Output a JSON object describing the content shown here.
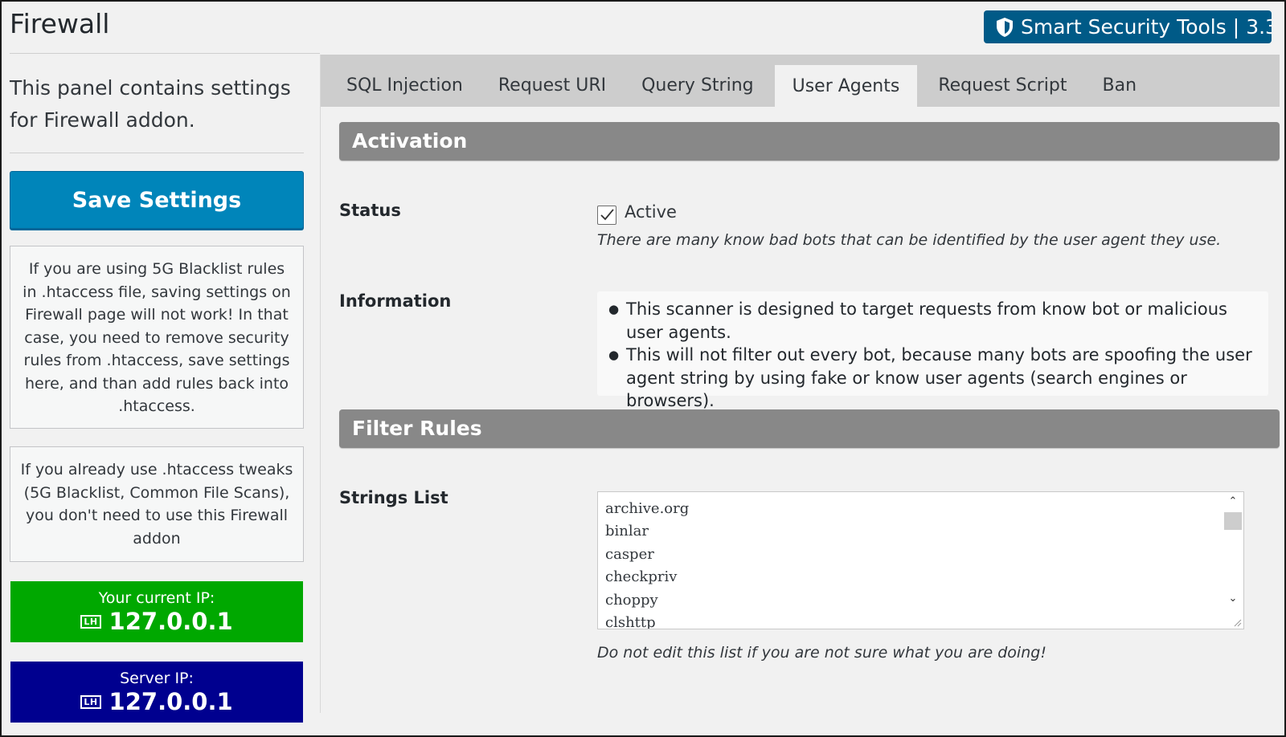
{
  "page": {
    "title": "Firewall"
  },
  "brand": {
    "name": "Smart Security Tools",
    "separator": "|",
    "version": "3.3",
    "icon": "shield-icon"
  },
  "sidebar": {
    "description": "This panel contains settings for Firewall addon.",
    "save_label": "Save Settings",
    "note_1": "If you are using 5G Blacklist rules in .htaccess file, saving settings on Firewall page will not work! In that case, you need to remove security rules from .htaccess, save settings here, and than add rules back into .htaccess.",
    "note_2": "If you already use .htaccess tweaks (5G Blacklist, Common File Scans), you don't need to use this Firewall addon",
    "current_ip_label": "Your current IP:",
    "current_ip_icon": "LH",
    "current_ip": "127.0.0.1",
    "server_ip_label": "Server IP:",
    "server_ip_icon": "LH",
    "server_ip": "127.0.0.1"
  },
  "tabs": [
    {
      "label": "SQL Injection",
      "active": false
    },
    {
      "label": "Request URI",
      "active": false
    },
    {
      "label": "Query String",
      "active": false
    },
    {
      "label": "User Agents",
      "active": true
    },
    {
      "label": "Request Script",
      "active": false
    },
    {
      "label": "Ban",
      "active": false
    }
  ],
  "activation": {
    "heading": "Activation",
    "status_label": "Status",
    "checkbox_label": "Active",
    "checked": true,
    "status_note": "There are many know bad bots that can be identified by the user agent they use.",
    "information_label": "Information",
    "info_items": [
      "This scanner is designed to target requests from know bot or malicious user agents.",
      "This will not filter out every bot, because many bots are spoofing the user agent string by using fake or know user agents (search engines or browsers)."
    ]
  },
  "filter_rules": {
    "heading": "Filter Rules",
    "strings_label": "Strings List",
    "strings": "archive.org\nbinlar\ncasper\ncheckpriv\nchoppy\nclshttp",
    "warning": "Do not edit this list if you are not sure what you are doing!"
  },
  "colors": {
    "brand": "#005a87",
    "save_button": "#0085ba",
    "current_ip_bg": "#00a800",
    "server_ip_bg": "#00008f",
    "section_head": "#888888"
  }
}
